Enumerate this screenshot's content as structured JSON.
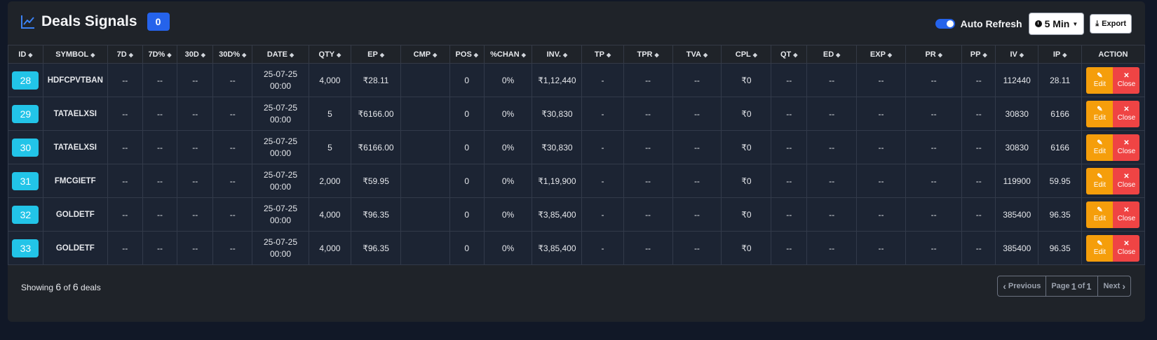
{
  "header": {
    "title": "Deals Signals",
    "badge": "0",
    "auto_refresh_label": "Auto Refresh",
    "interval": "5 Min",
    "export_label": "Export"
  },
  "columns": [
    "ID",
    "SYMBOL",
    "7D",
    "7D%",
    "30D",
    "30D%",
    "DATE",
    "QTY",
    "EP",
    "CMP",
    "POS",
    "%CHAN",
    "INV.",
    "TP",
    "TPR",
    "TVA",
    "CPL",
    "QT",
    "ED",
    "EXP",
    "PR",
    "PP",
    "IV",
    "IP",
    "ACTION"
  ],
  "rows": [
    {
      "id": "28",
      "symbol": "HDFCPVTBAN",
      "d7": "--",
      "d7p": "--",
      "d30": "--",
      "d30p": "--",
      "date1": "25-07-25",
      "date2": "00:00",
      "qty": "4,000",
      "ep": "₹28.11",
      "cmp": "",
      "pos": "0",
      "chan": "0%",
      "inv": "₹1,12,440",
      "tp": "-",
      "tpr": "--",
      "tva": "--",
      "cpl": "₹0",
      "qt": "--",
      "ed": "--",
      "exp": "--",
      "pr": "--",
      "pp": "--",
      "iv": "112440",
      "ip": "28.11"
    },
    {
      "id": "29",
      "symbol": "TATAELXSI",
      "d7": "--",
      "d7p": "--",
      "d30": "--",
      "d30p": "--",
      "date1": "25-07-25",
      "date2": "00:00",
      "qty": "5",
      "ep": "₹6166.00",
      "cmp": "",
      "pos": "0",
      "chan": "0%",
      "inv": "₹30,830",
      "tp": "-",
      "tpr": "--",
      "tva": "--",
      "cpl": "₹0",
      "qt": "--",
      "ed": "--",
      "exp": "--",
      "pr": "--",
      "pp": "--",
      "iv": "30830",
      "ip": "6166"
    },
    {
      "id": "30",
      "symbol": "TATAELXSI",
      "d7": "--",
      "d7p": "--",
      "d30": "--",
      "d30p": "--",
      "date1": "25-07-25",
      "date2": "00:00",
      "qty": "5",
      "ep": "₹6166.00",
      "cmp": "",
      "pos": "0",
      "chan": "0%",
      "inv": "₹30,830",
      "tp": "-",
      "tpr": "--",
      "tva": "--",
      "cpl": "₹0",
      "qt": "--",
      "ed": "--",
      "exp": "--",
      "pr": "--",
      "pp": "--",
      "iv": "30830",
      "ip": "6166"
    },
    {
      "id": "31",
      "symbol": "FMCGIETF",
      "d7": "--",
      "d7p": "--",
      "d30": "--",
      "d30p": "--",
      "date1": "25-07-25",
      "date2": "00:00",
      "qty": "2,000",
      "ep": "₹59.95",
      "cmp": "",
      "pos": "0",
      "chan": "0%",
      "inv": "₹1,19,900",
      "tp": "-",
      "tpr": "--",
      "tva": "--",
      "cpl": "₹0",
      "qt": "--",
      "ed": "--",
      "exp": "--",
      "pr": "--",
      "pp": "--",
      "iv": "119900",
      "ip": "59.95"
    },
    {
      "id": "32",
      "symbol": "GOLDETF",
      "d7": "--",
      "d7p": "--",
      "d30": "--",
      "d30p": "--",
      "date1": "25-07-25",
      "date2": "00:00",
      "qty": "4,000",
      "ep": "₹96.35",
      "cmp": "",
      "pos": "0",
      "chan": "0%",
      "inv": "₹3,85,400",
      "tp": "-",
      "tpr": "--",
      "tva": "--",
      "cpl": "₹0",
      "qt": "--",
      "ed": "--",
      "exp": "--",
      "pr": "--",
      "pp": "--",
      "iv": "385400",
      "ip": "96.35"
    },
    {
      "id": "33",
      "symbol": "GOLDETF",
      "d7": "--",
      "d7p": "--",
      "d30": "--",
      "d30p": "--",
      "date1": "25-07-25",
      "date2": "00:00",
      "qty": "4,000",
      "ep": "₹96.35",
      "cmp": "",
      "pos": "0",
      "chan": "0%",
      "inv": "₹3,85,400",
      "tp": "-",
      "tpr": "--",
      "tva": "--",
      "cpl": "₹0",
      "qt": "--",
      "ed": "--",
      "exp": "--",
      "pr": "--",
      "pp": "--",
      "iv": "385400",
      "ip": "96.35"
    }
  ],
  "actions": {
    "edit_label": "Edit",
    "close_label": "Close"
  },
  "footer": {
    "showing_prefix": "Showing",
    "showing_count": "6",
    "showing_of": "of",
    "showing_total": "6",
    "showing_suffix": "deals",
    "prev_label": "Previous",
    "page_prefix": "Page",
    "page_current": "1",
    "page_of": "of",
    "page_total": "1",
    "next_label": "Next"
  },
  "colors": {
    "accent": "#2563eb",
    "id_badge": "#22c4e8",
    "edit": "#f59e0b",
    "close": "#ef4444"
  }
}
